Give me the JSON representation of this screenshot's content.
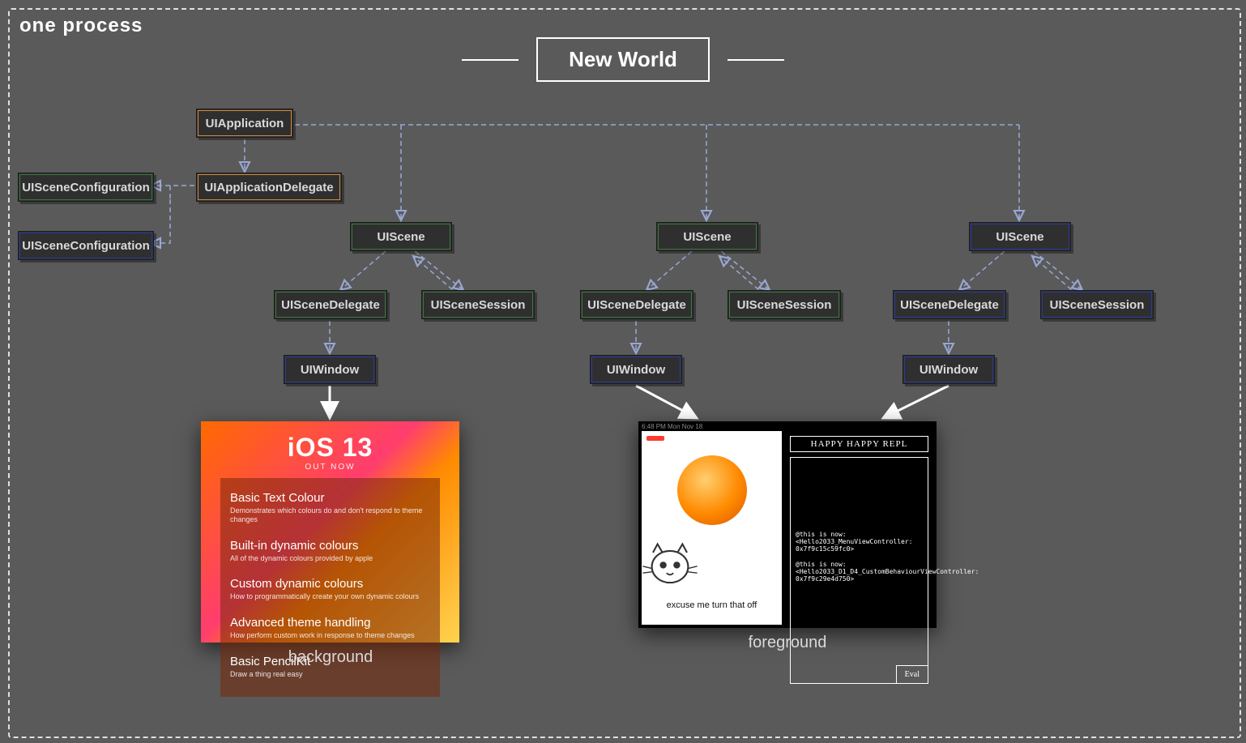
{
  "process_label": "one process",
  "title": "New World",
  "nodes": {
    "uiapp": "UIApplication",
    "appdelegate": "UIApplicationDelegate",
    "sceneconfig": "UISceneConfiguration",
    "scene": "UIScene",
    "scenedelegate": "UISceneDelegate",
    "scenesession": "UISceneSession",
    "window": "UIWindow"
  },
  "captions": {
    "background": "background",
    "foreground": "foreground"
  },
  "ios13": {
    "title": "iOS 13",
    "subtitle": "OUT NOW",
    "items": [
      {
        "h": "Basic Text Colour",
        "p": "Demonstrates which colours do and don't respond to theme changes"
      },
      {
        "h": "Built-in dynamic colours",
        "p": "All of the dynamic colours provided by apple"
      },
      {
        "h": "Custom dynamic colours",
        "p": "How to programmatically create your own dynamic colours"
      },
      {
        "h": "Advanced theme handling",
        "p": "How perform custom work in response to theme changes"
      },
      {
        "h": "Basic PencilKit",
        "p": "Draw a thing real easy"
      }
    ]
  },
  "leftpane": {
    "caption": "excuse me turn that off",
    "status": "6:48 PM  Mon Nov 18"
  },
  "repl": {
    "title": "HAPPY HAPPY REPL",
    "lines": [
      "@this is now:",
      "<Hello2033_MenuViewController: 0x7f9c15c59fc0>",
      "@this is now:",
      "<Hello2033_D1_D4_CustomBehaviourViewController: 0x7f9c29e4d750>"
    ],
    "eval": "Eval"
  }
}
